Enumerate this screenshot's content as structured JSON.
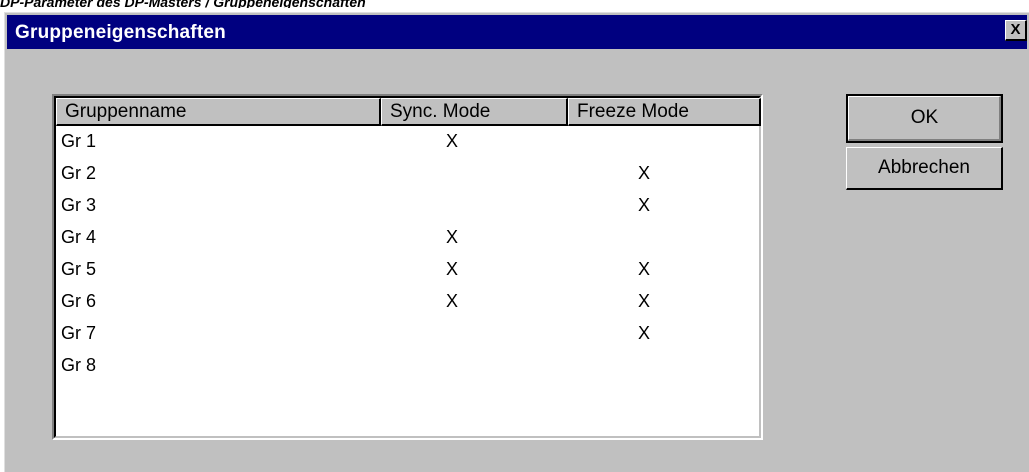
{
  "caption": "DP-Parameter des DP-Masters / Gruppeneigenschaften",
  "dialog": {
    "title": "Gruppeneigenschaften",
    "close_label": "X",
    "ok_label": "OK",
    "cancel_label": "Abbrechen"
  },
  "table": {
    "columns": [
      "Gruppenname",
      "Sync. Mode",
      "Freeze Mode"
    ],
    "rows": [
      {
        "name": "Gr 1",
        "sync": "X",
        "freeze": ""
      },
      {
        "name": "Gr 2",
        "sync": "",
        "freeze": "X"
      },
      {
        "name": "Gr 3",
        "sync": "",
        "freeze": "X"
      },
      {
        "name": "Gr 4",
        "sync": "X",
        "freeze": ""
      },
      {
        "name": "Gr 5",
        "sync": "X",
        "freeze": "X"
      },
      {
        "name": "Gr 6",
        "sync": "X",
        "freeze": "X"
      },
      {
        "name": "Gr 7",
        "sync": "",
        "freeze": "X"
      },
      {
        "name": "Gr 8",
        "sync": "",
        "freeze": ""
      }
    ]
  },
  "colors": {
    "titlebar": "#000080",
    "dialog_bg": "#c0c0c0",
    "list_bg": "#ffffff"
  }
}
